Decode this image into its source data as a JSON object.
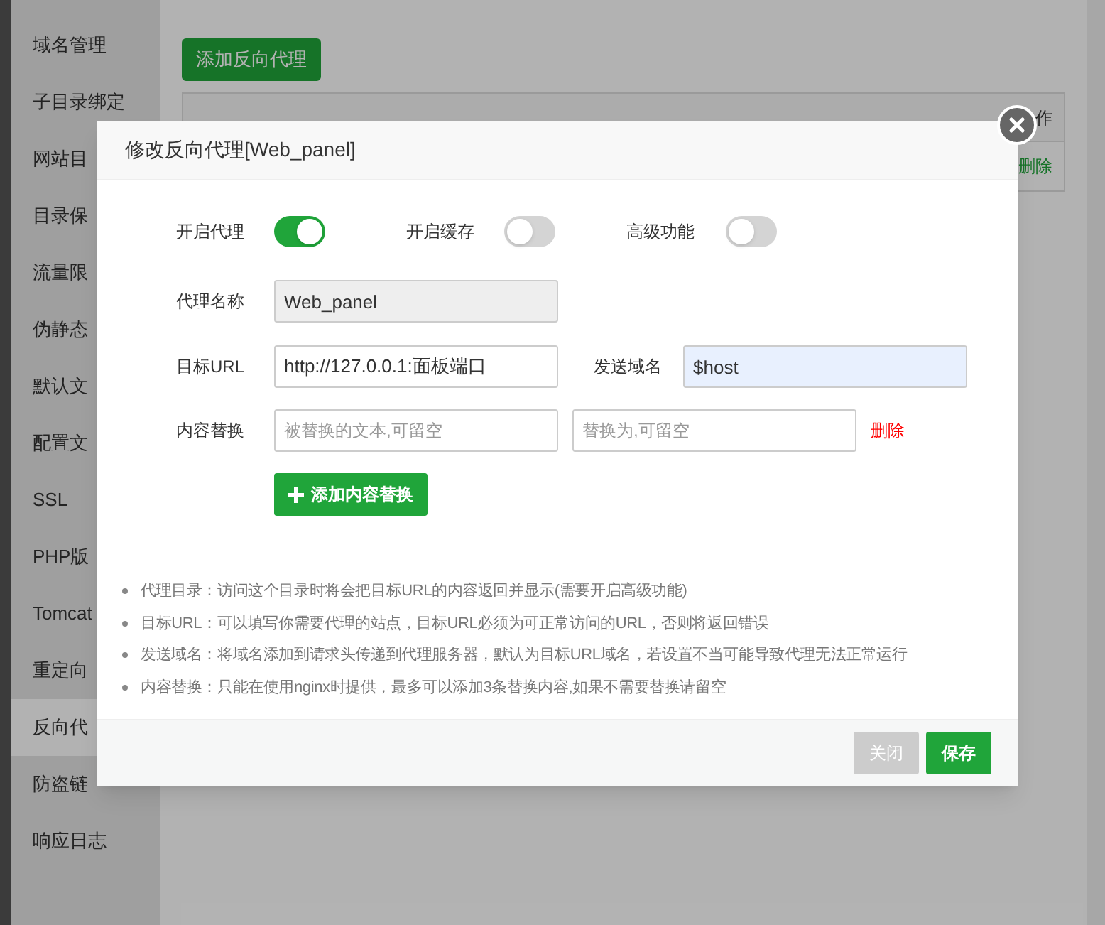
{
  "sidebar": {
    "items": [
      {
        "label": "域名管理",
        "selected": false
      },
      {
        "label": "子目录绑定",
        "selected": false
      },
      {
        "label": "网站目",
        "selected": false
      },
      {
        "label": "目录保",
        "selected": false
      },
      {
        "label": "流量限",
        "selected": false
      },
      {
        "label": "伪静态",
        "selected": false
      },
      {
        "label": "默认文",
        "selected": false
      },
      {
        "label": "配置文",
        "selected": false
      },
      {
        "label": "SSL",
        "selected": false
      },
      {
        "label": "PHP版",
        "selected": false
      },
      {
        "label": "Tomcat",
        "selected": false
      },
      {
        "label": "重定向",
        "selected": false
      },
      {
        "label": "反向代",
        "selected": true
      },
      {
        "label": "防盗链",
        "selected": false
      },
      {
        "label": "响应日志",
        "selected": false
      }
    ]
  },
  "page": {
    "add_button": "添加反向代理",
    "table": {
      "columns": [
        "作"
      ],
      "rows": [
        {
          "action": "删除"
        }
      ]
    }
  },
  "dialog": {
    "title": "修改反向代理[Web_panel]",
    "toggles": [
      {
        "label": "开启代理",
        "on": true
      },
      {
        "label": "开启缓存",
        "on": false
      },
      {
        "label": "高级功能",
        "on": false
      }
    ],
    "fields": [
      {
        "label": "代理名称",
        "value": "Web_panel",
        "disabled": true,
        "autofilled": false
      },
      {
        "label": "目标URL",
        "value": "http://127.0.0.1:面板端口",
        "disabled": false,
        "autofilled": false
      },
      {
        "label": "发送域名",
        "value": "$host",
        "disabled": false,
        "autofilled": true
      }
    ],
    "content_replace": {
      "label": "内容替换",
      "placeholders": [
        "被替换的文本,可留空",
        "替换为,可留空"
      ],
      "delete": "删除"
    },
    "add_replace_button": "添加内容替换",
    "notes": [
      "代理目录：访问这个目录时将会把目标URL的内容返回并显示(需要开启高级功能)",
      "目标URL：可以填写你需要代理的站点，目标URL必须为可正常访问的URL，否则将返回错误",
      "发送域名：将域名添加到请求头传递到代理服务器，默认为目标URL域名，若设置不当可能导致代理无法正常运行",
      "内容替换：只能在使用nginx时提供，最多可以添加3条替换内容,如果不需要替换请留空"
    ],
    "buttons": [
      {
        "label": "关闭",
        "disabled": true
      },
      {
        "label": "保存",
        "disabled": false
      }
    ]
  }
}
